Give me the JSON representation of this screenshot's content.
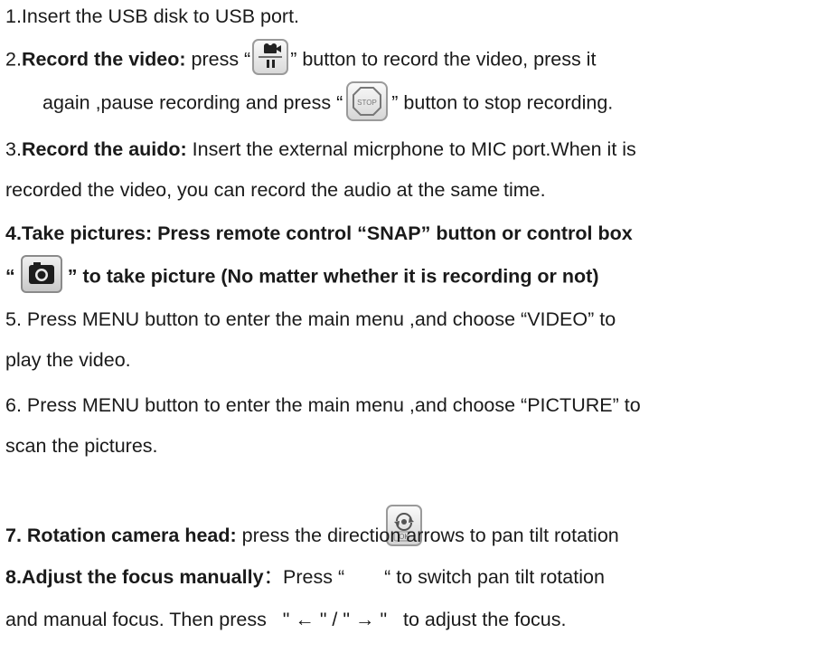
{
  "steps": {
    "s1": {
      "text": "1.Insert the USB disk to USB port."
    },
    "s2": {
      "label": "2.",
      "title": "Record the video:",
      "a": " press “",
      "b": "” button to record the video, press it",
      "c": "again ,pause recording and press “",
      "d": "” button to stop recording.",
      "record_icon": "record-pause-icon",
      "stop_icon": "stop-icon",
      "stop_icon_text": "STOP"
    },
    "s3": {
      "label": "3.",
      "title": "Record the auido:",
      "a": " Insert the external micrphone to MIC port.When it is",
      "b": "recorded the video, you can record the audio at the same time."
    },
    "s4": {
      "line1": "4.Take pictures: Press remote control “SNAP” button or control box",
      "open": "“",
      "tail": "” to take picture (No matter whether it is recording or not)",
      "snap_icon": "camera-icon"
    },
    "s5": {
      "a": "5. Press MENU button to enter the main menu ,and choose “VIDEO” to",
      "b": "play the video."
    },
    "s6": {
      "a": "6. Press MENU button to enter the main menu ,and choose “PICTURE” to",
      "b": "scan the pictures."
    },
    "s7": {
      "title": "7. Rotation camera head:",
      "a": " press the direction arrows to pan tilt rotation"
    },
    "s8": {
      "title": "8.Adjust the focus manually",
      "a": "：Press “",
      "b": "“ to switch pan tilt rotation",
      "c": "and manual focus. Then press   \" ← \" / \" → \"   to adjust the focus.",
      "ok_icon": "ok-rotate-icon",
      "ok_icon_text": "OK"
    }
  }
}
